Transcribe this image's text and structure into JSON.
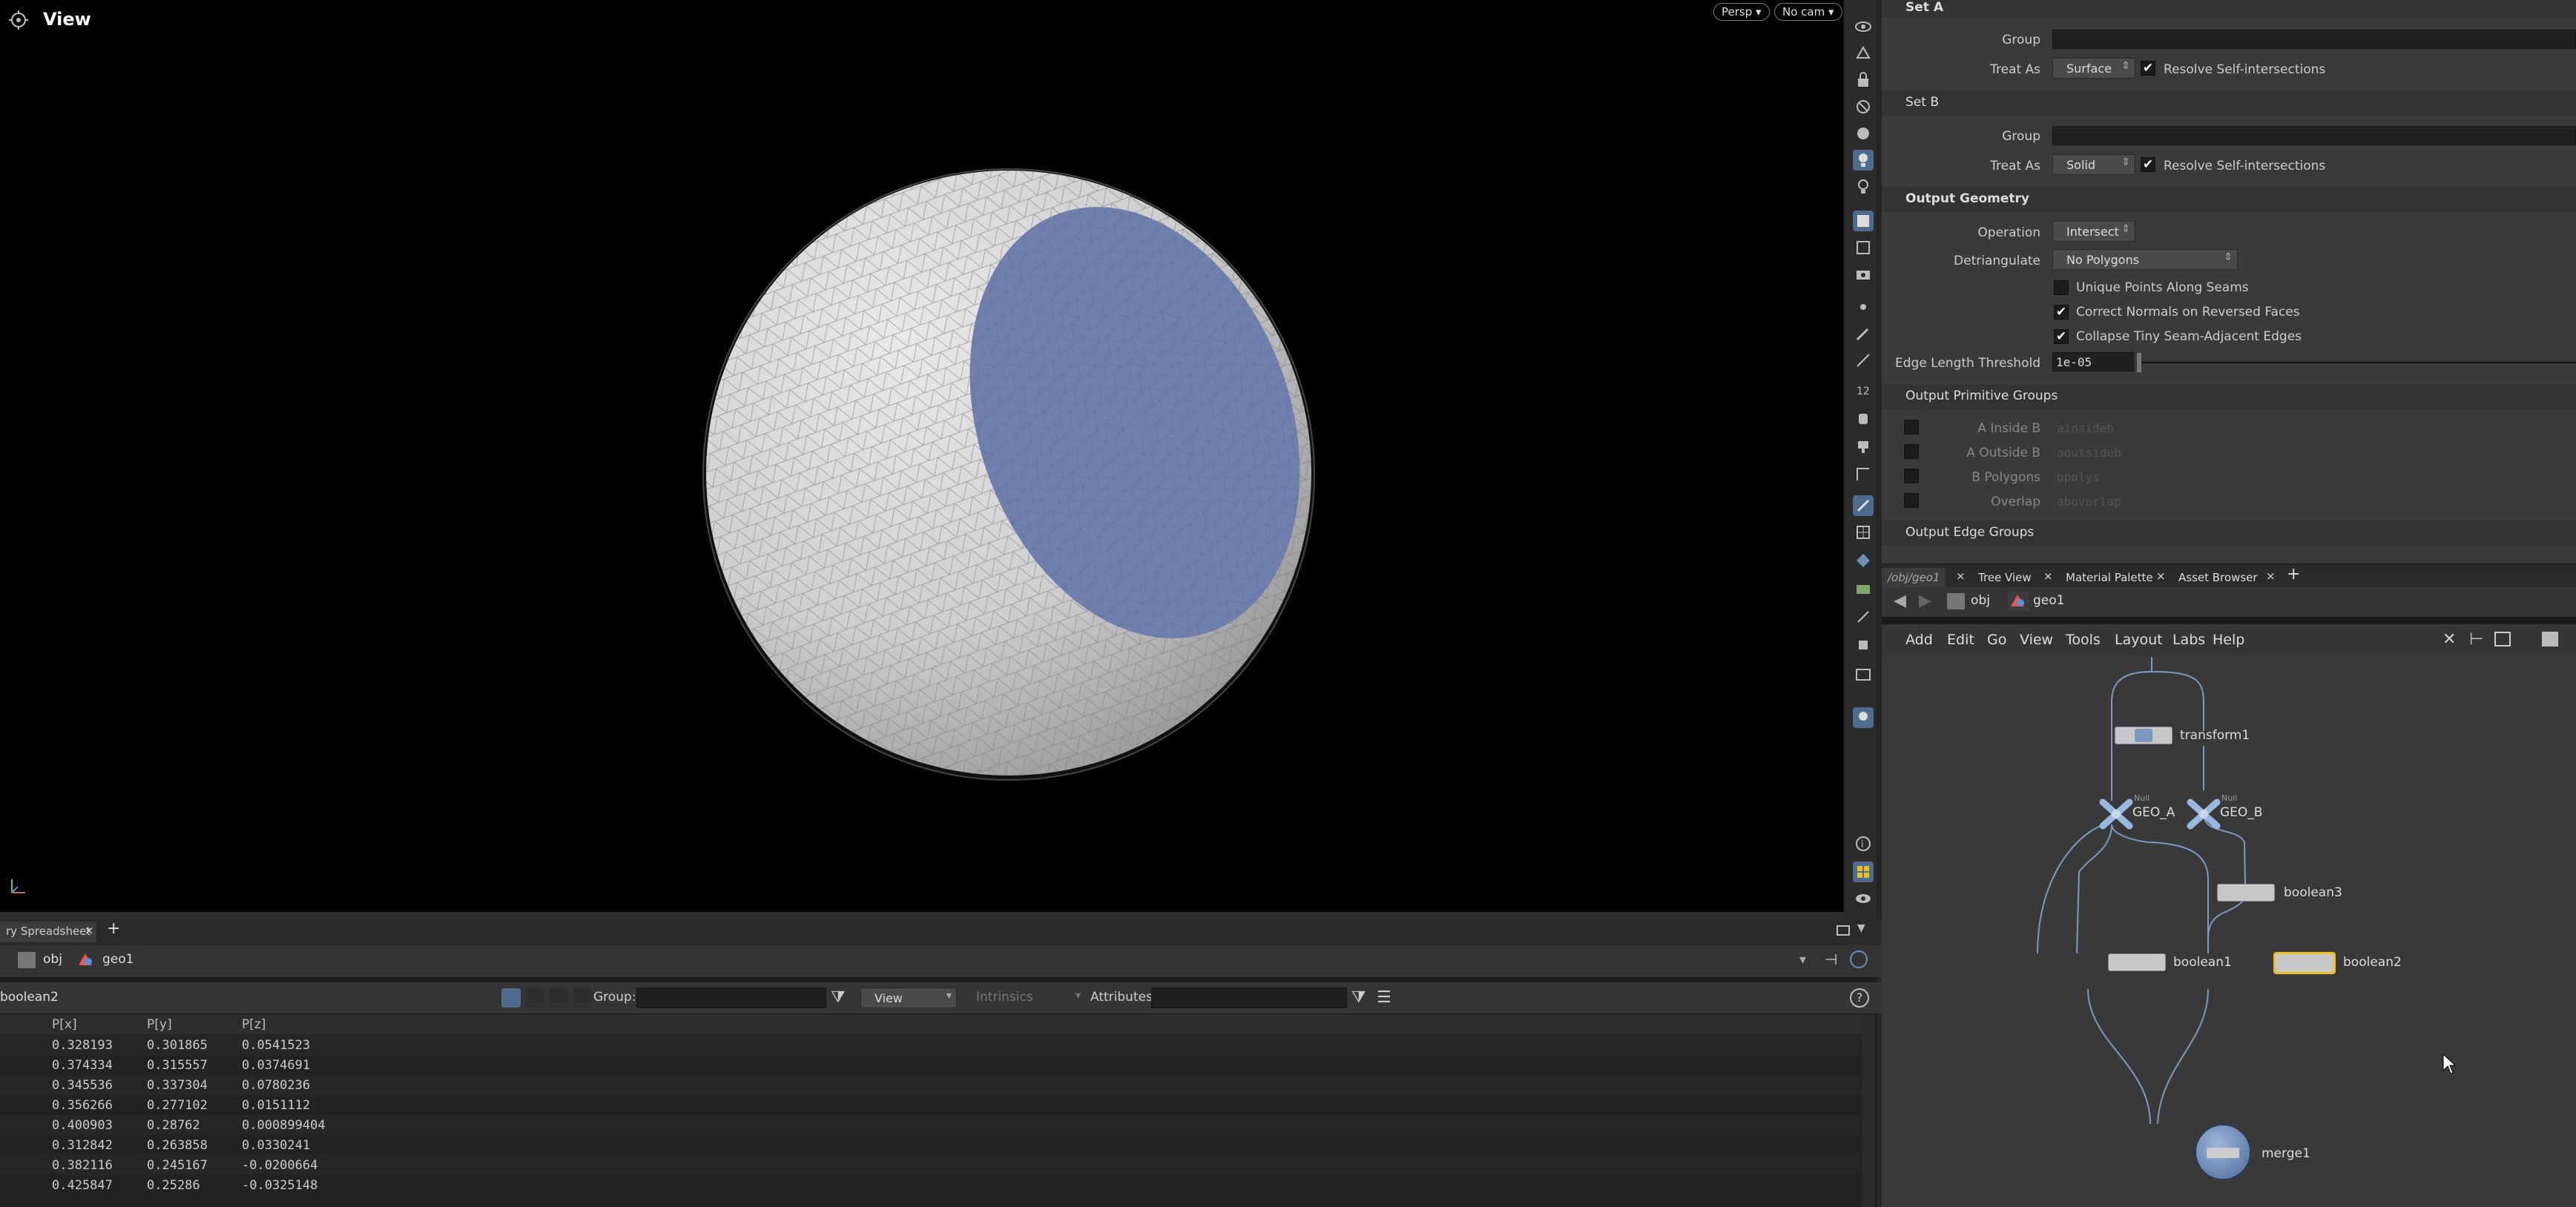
{
  "viewport": {
    "title": "View",
    "persp_label": "Persp",
    "cam_label": "No cam",
    "axis_label": "x y z"
  },
  "params": {
    "set_a": {
      "header": "Set A",
      "group_label": "Group",
      "group_value": "",
      "treat_as_label": "Treat As",
      "treat_as_value": "Surface",
      "resolve_label": "Resolve Self-intersections",
      "resolve_checked": true
    },
    "set_b": {
      "header": "Set B",
      "group_label": "Group",
      "group_value": "",
      "treat_as_label": "Treat As",
      "treat_as_value": "Solid",
      "resolve_label": "Resolve Self-intersections",
      "resolve_checked": true
    },
    "output_geometry": {
      "header": "Output Geometry",
      "operation_label": "Operation",
      "operation_value": "Intersect",
      "detriangulate_label": "Detriangulate",
      "detriangulate_value": "No Polygons",
      "unique_points_label": "Unique Points Along Seams",
      "unique_points_checked": false,
      "correct_normals_label": "Correct Normals on Reversed Faces",
      "correct_normals_checked": true,
      "collapse_label": "Collapse Tiny Seam-Adjacent Edges",
      "collapse_checked": true,
      "edge_threshold_label": "Edge Length Threshold",
      "edge_threshold_value": "1e-05"
    },
    "output_primitive_groups": {
      "header": "Output Primitive Groups",
      "items": [
        {
          "label": "A Inside B",
          "value": "ainsideb"
        },
        {
          "label": "A Outside B",
          "value": "aoutsideb"
        },
        {
          "label": "B Polygons",
          "value": "bpolys"
        },
        {
          "label": "Overlap",
          "value": "aboverlap"
        }
      ]
    },
    "output_edge_groups": {
      "header": "Output Edge Groups"
    }
  },
  "network": {
    "tabs": [
      {
        "label": "/obj/geo1",
        "active": true
      },
      {
        "label": "Tree View",
        "active": false
      },
      {
        "label": "Material Palette",
        "active": false
      },
      {
        "label": "Asset Browser",
        "active": false
      }
    ],
    "path": [
      "obj",
      "geo1"
    ],
    "menu": [
      "Add",
      "Edit",
      "Go",
      "View",
      "Tools",
      "Layout",
      "Labs",
      "Help"
    ],
    "nodes": {
      "transform1": "transform1",
      "geo_a": "GEO_A",
      "geo_b": "GEO_B",
      "boolean3": "boolean3",
      "boolean1": "boolean1",
      "boolean2": "boolean2",
      "merge1": "merge1",
      "null_tag": "Null"
    }
  },
  "spreadsheet": {
    "tab_label": "ry Spreadsheet",
    "path": [
      "obj",
      "geo1"
    ],
    "node_name": "boolean2",
    "group_label": "Group:",
    "view_label": "View",
    "intrinsics_label": "Intrinsics",
    "attributes_label": "Attributes:",
    "columns": [
      "P[x]",
      "P[y]",
      "P[z]"
    ],
    "rows": [
      [
        "0.328193",
        "0.301865",
        "0.0541523"
      ],
      [
        "0.374334",
        "0.315557",
        "0.0374691"
      ],
      [
        "0.345536",
        "0.337304",
        "0.0780236"
      ],
      [
        "0.356266",
        "0.277102",
        "0.0151112"
      ],
      [
        "0.400903",
        "0.28762",
        "0.000899404"
      ],
      [
        "0.312842",
        "0.263858",
        "0.0330241"
      ],
      [
        "0.382116",
        "0.245167",
        "-0.0200664"
      ],
      [
        "0.425847",
        "0.25286",
        "-0.0325148"
      ]
    ]
  },
  "colors": {
    "selected_node": "#e8c020",
    "highlight_blue": "#4e6a8c",
    "sphere_cut": "#6f7fae"
  }
}
